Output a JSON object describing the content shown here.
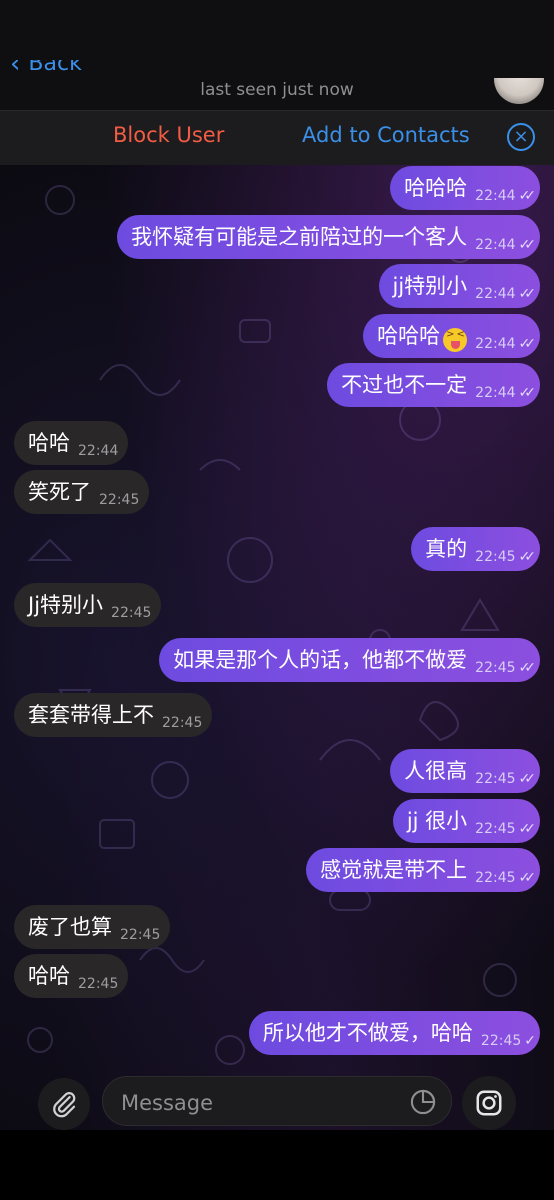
{
  "header": {
    "back_label": "Back",
    "status": "last seen just now"
  },
  "action_bar": {
    "block_label": "Block User",
    "add_label": "Add to Contacts",
    "close_icon": "×"
  },
  "colors": {
    "outgoing_bubble": "#7b4de0",
    "incoming_bubble": "#2a2728",
    "block_red": "#f25c44",
    "link_blue": "#3a8fe8"
  },
  "messages": [
    {
      "direction": "out",
      "text": "哈哈哈",
      "time": "22:44",
      "read": true
    },
    {
      "direction": "out",
      "text": "我怀疑有可能是之前陪过的一个客人",
      "time": "22:44",
      "read": true
    },
    {
      "direction": "out",
      "text": "jj特别小",
      "time": "22:44",
      "read": true
    },
    {
      "direction": "out",
      "text": "哈哈哈",
      "time": "22:44",
      "read": true,
      "emoji": "squinting-face-with-tongue"
    },
    {
      "direction": "out",
      "text": "不过也不一定",
      "time": "22:44",
      "read": true
    },
    {
      "direction": "in",
      "text": "哈哈",
      "time": "22:44"
    },
    {
      "direction": "in",
      "text": "笑死了",
      "time": "22:45"
    },
    {
      "direction": "out",
      "text": "真的",
      "time": "22:45",
      "read": true
    },
    {
      "direction": "in",
      "text": "Jj特别小",
      "time": "22:45"
    },
    {
      "direction": "out",
      "text": "如果是那个人的话，他都不做爱",
      "time": "22:45",
      "read": true
    },
    {
      "direction": "in",
      "text": "套套带得上不",
      "time": "22:45"
    },
    {
      "direction": "out",
      "text": "人很高",
      "time": "22:45",
      "read": true
    },
    {
      "direction": "out",
      "text": "jj 很小",
      "time": "22:45",
      "read": true
    },
    {
      "direction": "out",
      "text": "感觉就是带不上",
      "time": "22:45",
      "read": true
    },
    {
      "direction": "in",
      "text": "废了也算",
      "time": "22:45"
    },
    {
      "direction": "in",
      "text": "哈哈",
      "time": "22:45"
    },
    {
      "direction": "out",
      "text": "所以他才不做爱，哈哈",
      "time": "22:45",
      "read": false
    }
  ],
  "input": {
    "placeholder": "Message"
  },
  "icons": {
    "attach": "paperclip-icon",
    "sticker": "sticker-icon",
    "camera": "camera-icon"
  }
}
